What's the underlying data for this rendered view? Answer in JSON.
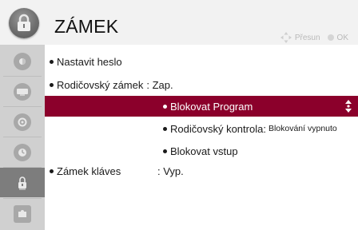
{
  "header": {
    "title": "ZÁMEK",
    "hint_move": "Přesun",
    "hint_ok": "OK"
  },
  "sidebar": {
    "items": [
      {
        "icon": "picture-icon"
      },
      {
        "icon": "screen-icon"
      },
      {
        "icon": "settings-icon"
      },
      {
        "icon": "time-icon"
      },
      {
        "icon": "lock-icon",
        "active": true
      },
      {
        "icon": "option-icon"
      }
    ]
  },
  "menu": {
    "set_password": "Nastavit heslo",
    "parental_lock_label": "Rodičovský zámek",
    "parental_lock_value": ": Zap.",
    "block_program": "Blokovat Program",
    "parental_control_label": "Rodičovský kontrola:",
    "parental_control_value": "Blokování vypnuto",
    "block_input": "Blokovat vstup",
    "key_lock_label": "Zámek kláves",
    "key_lock_value": ": Vyp."
  },
  "colors": {
    "selection": "#8b002b",
    "sidebar": "#d0d0d0",
    "sidebar_active": "#7d7d7d"
  }
}
